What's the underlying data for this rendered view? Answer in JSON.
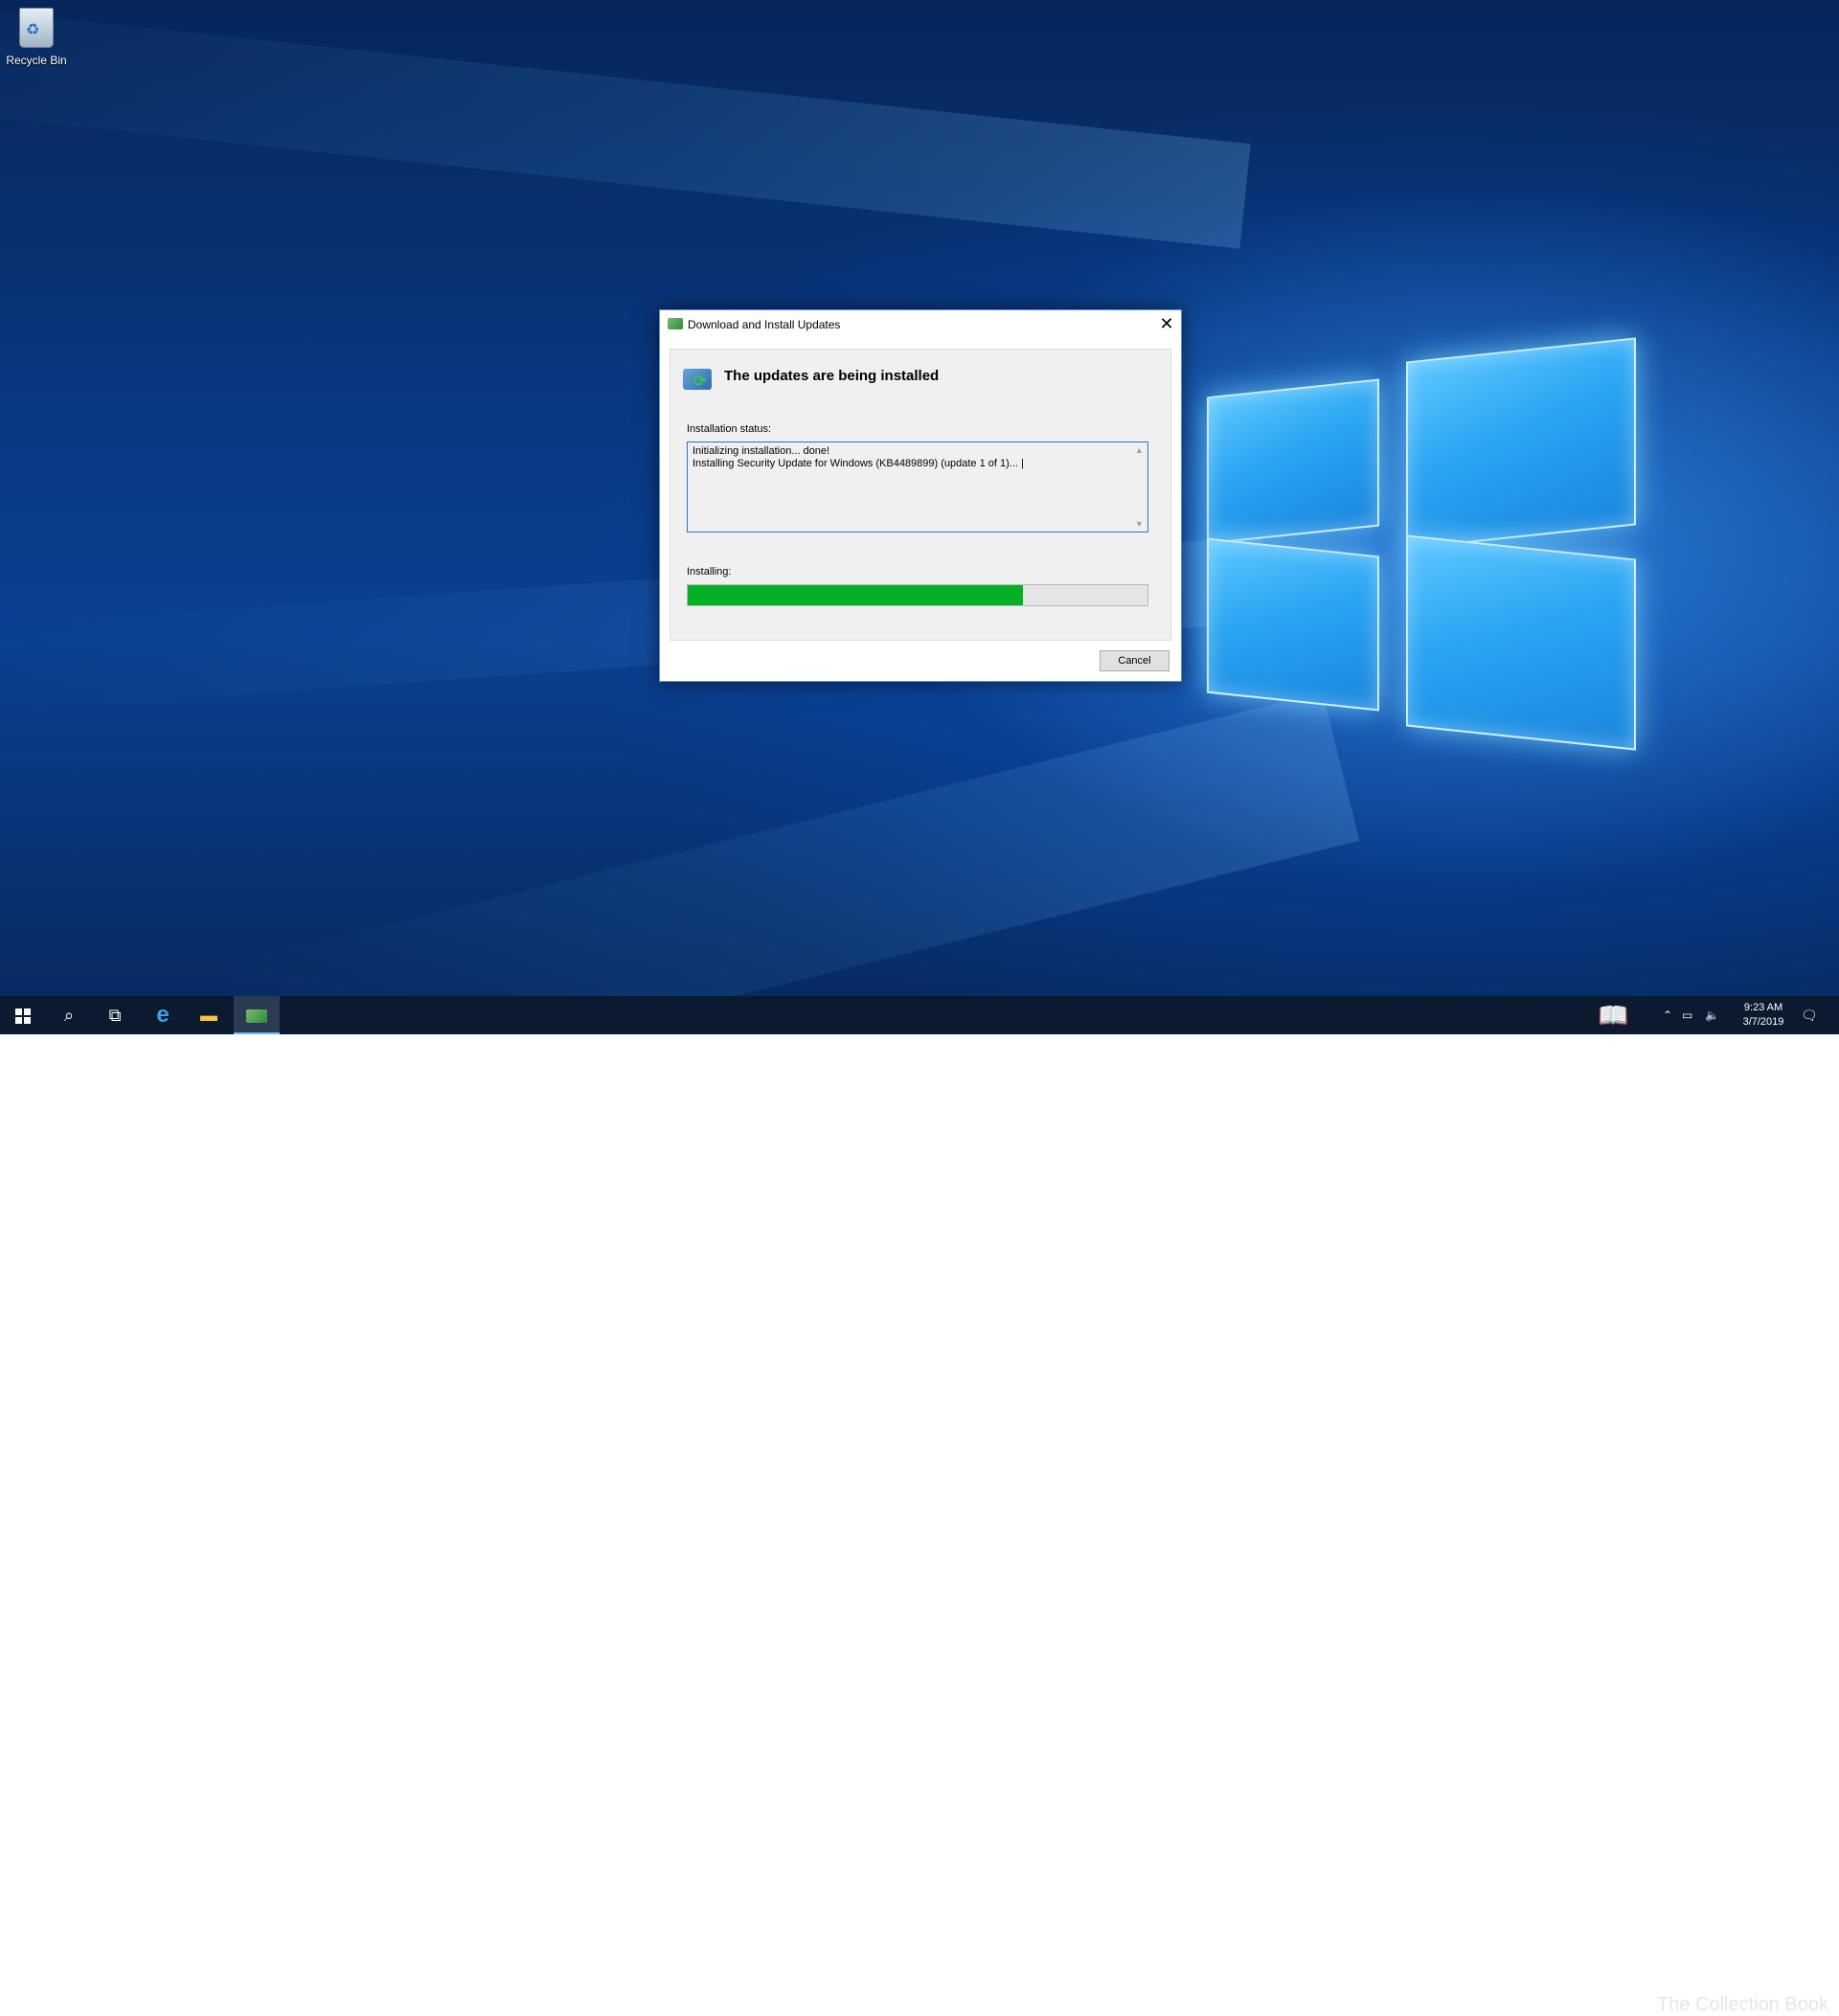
{
  "desktop": {
    "icons": [
      {
        "label": "Recycle Bin",
        "icon": "recycle-bin-icon"
      }
    ]
  },
  "dialog": {
    "title": "Download and Install Updates",
    "close_label": "✕",
    "heading": "The updates are being installed",
    "status_label": "Installation status:",
    "status_lines": [
      "Initializing installation... done!",
      "Installing Security Update for Windows (KB4489899) (update 1 of 1)... |"
    ],
    "progress_label": "Installing:",
    "progress_fraction": 0.73,
    "progress_color": "#06b025",
    "cancel_label": "Cancel"
  },
  "taskbar": {
    "buttons": [
      "start-icon",
      "search-icon",
      "task-view-icon",
      "internet-explorer-icon",
      "file-explorer-icon",
      "windows-update-icon"
    ],
    "active_button": "windows-update-icon",
    "watermark": "The Collection Book",
    "clock": {
      "time": "9:23 AM",
      "date": "3/7/2019"
    }
  }
}
